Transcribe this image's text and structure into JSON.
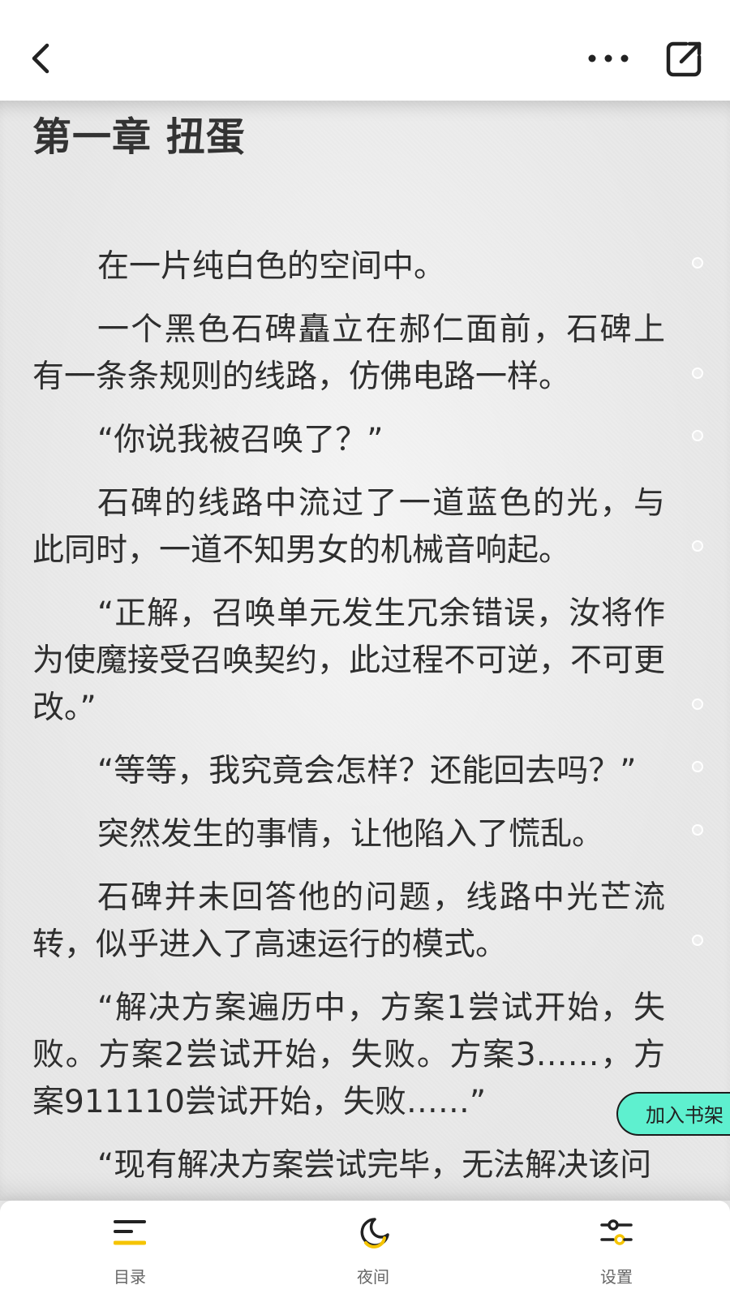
{
  "icons": {
    "back": "chevron-left-icon",
    "more": "more-dots-icon",
    "share": "share-icon",
    "toc": "menu-list-icon",
    "night": "moon-icon",
    "settings": "sliders-icon"
  },
  "colors": {
    "accent_yellow": "#f5c400",
    "shelf_button": "#5ef0cf",
    "text": "#2e2e2e"
  },
  "chapter": {
    "title": "第一章 扭蛋",
    "paragraphs": [
      "在一片纯白色的空间中。",
      "一个黑色石碑矗立在郝仁面前，石碑上有一条条规则的线路，仿佛电路一样。",
      "“你说我被召唤了？”",
      "石碑的线路中流过了一道蓝色的光，与此同时，一道不知男女的机械音响起。",
      "“正解，召唤单元发生冗余错误，汝将作为使魔接受召唤契约，此过程不可逆，不可更改。”",
      "“等等，我究竟会怎样？还能回去吗？”",
      "突然发生的事情，让他陷入了慌乱。",
      "石碑并未回答他的问题，线路中光芒流转，似乎进入了高速运行的模式。",
      "“解决方案遍历中，方案1尝试开始，失败。方案2尝试开始，失败。方案3……，方案911110尝试开始，失败……”",
      "“现有解决方案尝试完毕，无法解决该问"
    ]
  },
  "shelf_button": "加入书架",
  "bottom_nav": {
    "toc_label": "目录",
    "night_label": "夜间",
    "settings_label": "设置"
  }
}
